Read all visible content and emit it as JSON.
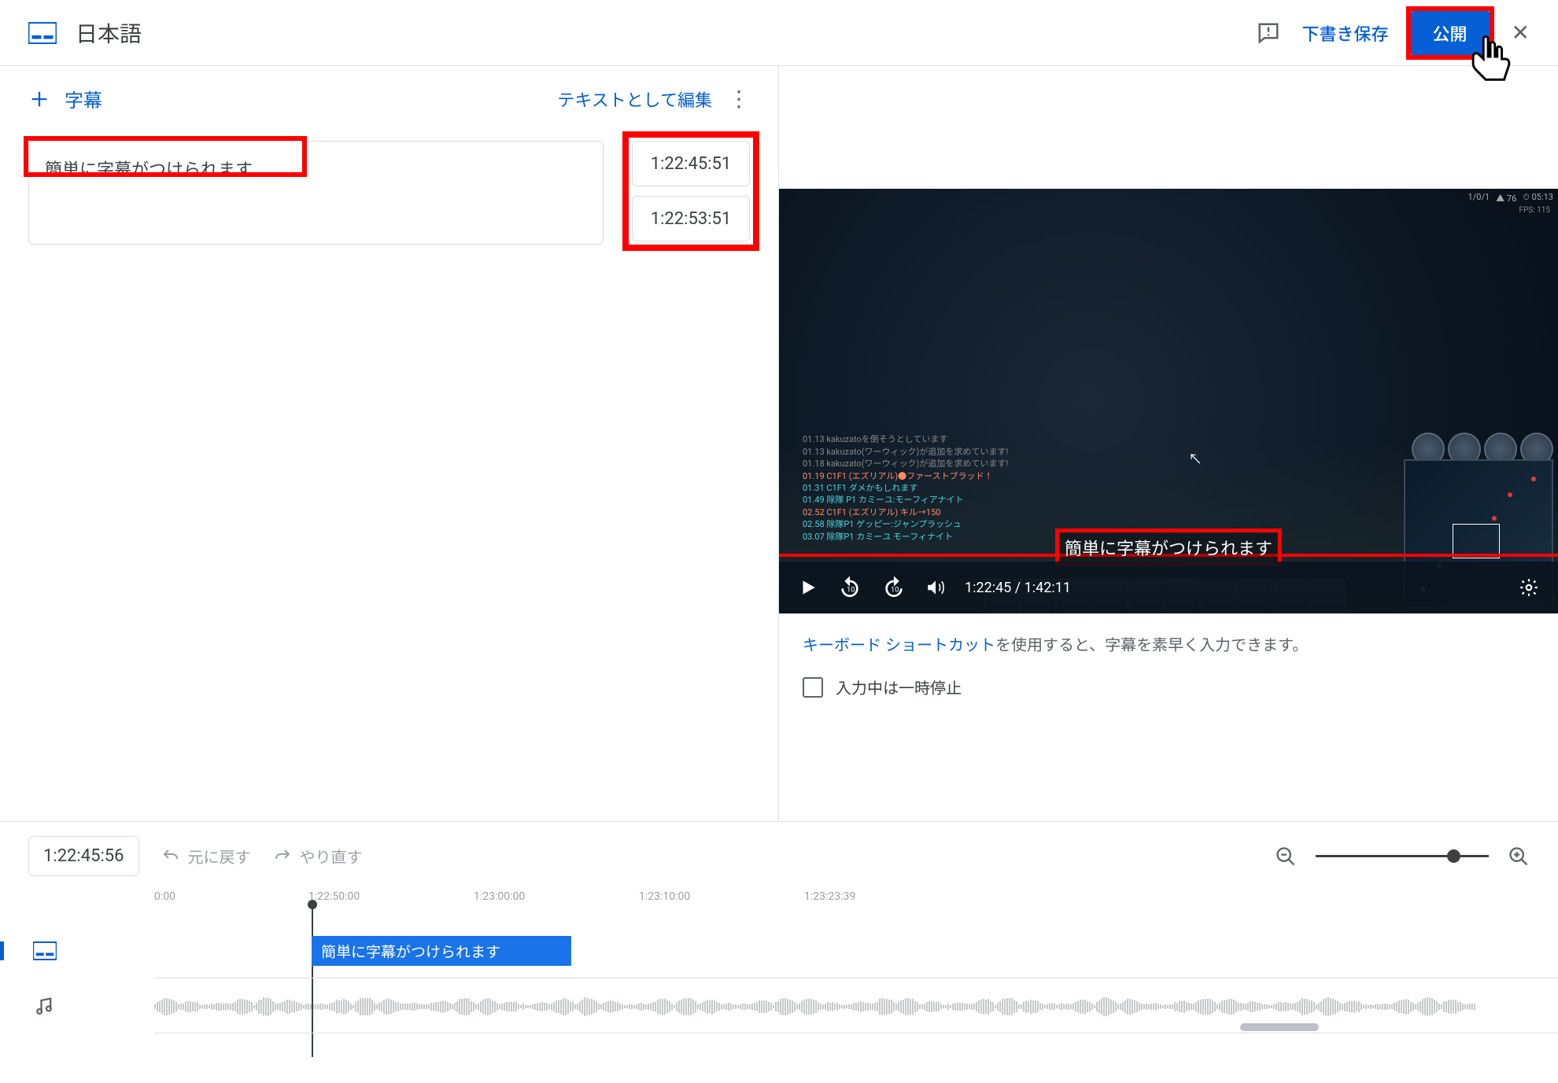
{
  "header": {
    "language": "日本語",
    "save_draft": "下書き保存",
    "publish": "公開"
  },
  "left_panel": {
    "add_caption": "字幕",
    "edit_as_text": "テキストとして編集",
    "caption_text": "簡単に字幕がつけられます",
    "start_time": "1:22:45:51",
    "end_time": "1:22:53:51"
  },
  "video": {
    "overlay_caption": "簡単に字幕がつけられます",
    "current_time": "1:22:45",
    "duration": "1:42:11",
    "hud": {
      "players": "1/0/1",
      "cs": "76",
      "clock": "05:13",
      "fps": "FPS: 115"
    },
    "chat": [
      {
        "t": "01.13",
        "txt": "kakuzatoを倒そうとしています",
        "cls": ""
      },
      {
        "t": "01.13",
        "txt": "kakuzato(ワーウィック)が追加を求めています!",
        "cls": ""
      },
      {
        "t": "01.18",
        "txt": "kakuzato(ワーウィック)が追加を求めています!",
        "cls": ""
      },
      {
        "t": "01.19",
        "txt": "C1F1 (エズリアル)●ファーストブラッド！",
        "cls": "orange"
      },
      {
        "t": "01.31",
        "txt": "C1F1 ダメかもしれます",
        "cls": "cyan"
      },
      {
        "t": "01.49",
        "txt": "除隊 P1  カミーユ:モーフィアナイト",
        "cls": "cyan"
      },
      {
        "t": "02.52",
        "txt": "C1F1 (エズリアル) キル→150",
        "cls": "orange"
      },
      {
        "t": "02.58",
        "txt": "除隊P1 ゲッピー:ジャンプラッシュ",
        "cls": "cyan"
      },
      {
        "t": "03.07",
        "txt": "除隊P1 カミーユ モーフィナイト",
        "cls": "cyan"
      }
    ]
  },
  "hint": {
    "link_text": "キーボード ショートカット",
    "rest_text": "を使用すると、字幕を素早く入力できます。"
  },
  "pause_check": "入力中は一時停止",
  "timeline": {
    "current": "1:22:45:56",
    "undo": "元に戻す",
    "redo": "やり直す",
    "ruler": [
      "0:00",
      "1:22:50:00",
      "1:23:00:00",
      "1:23:10:00",
      "1:23:23:39"
    ],
    "caption_block": "簡単に字幕がつけられます"
  }
}
